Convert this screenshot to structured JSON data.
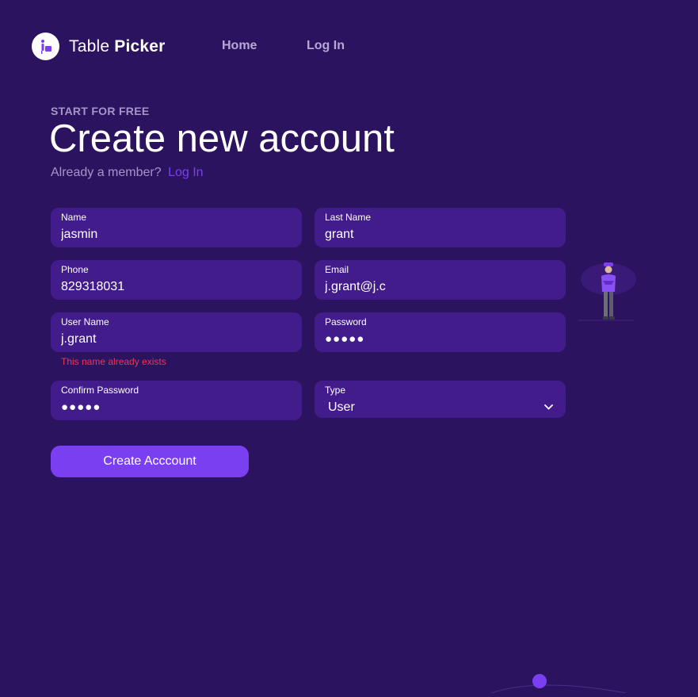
{
  "brand": {
    "name_regular": "Table ",
    "name_bold": "Picker",
    "logo_icon": "person-table-icon"
  },
  "nav": {
    "home": "Home",
    "login": "Log In"
  },
  "heading": {
    "eyebrow": "START FOR FREE",
    "title": "Create new account",
    "member_text": "Already a member?",
    "member_link": "Log In"
  },
  "form": {
    "name": {
      "label": "Name",
      "value": "jasmin"
    },
    "last_name": {
      "label": "Last Name",
      "value": "grant"
    },
    "phone": {
      "label": "Phone",
      "value": "829318031"
    },
    "email": {
      "label": "Email",
      "value": "j.grant@j.c"
    },
    "username": {
      "label": "User Name",
      "value": "j.grant",
      "error": "This name already exists"
    },
    "password": {
      "label": "Password",
      "value": "●●●●●"
    },
    "confirm_password": {
      "label": "Confirm Password",
      "value": "●●●●●"
    },
    "type": {
      "label": "Type",
      "value": "User"
    },
    "submit": "Create Acccount"
  },
  "colors": {
    "background": "#2c1360",
    "field": "#431c8c",
    "accent": "#7b3ff2",
    "error": "#e8375a",
    "muted": "#a596c8"
  }
}
